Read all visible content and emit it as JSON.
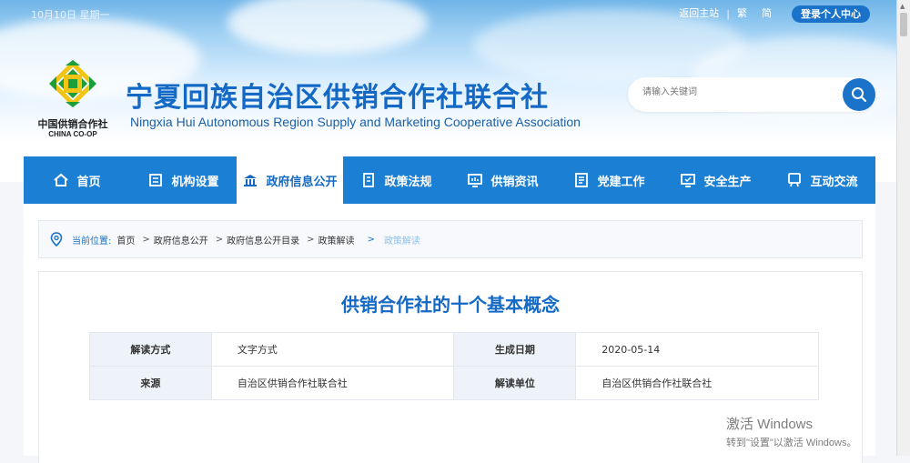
{
  "topbar": {
    "date": "10月10日 星期一",
    "home_link": "返回主站",
    "separator": "|",
    "trad": "繁",
    "simp": "简",
    "login": "登录个人中心"
  },
  "header": {
    "logo_text_cn": "中国供销合作社",
    "logo_text_en": "CHINA CO-OP",
    "title_cn": "宁夏回族自治区供销合作社联合社",
    "title_en": "Ningxia Hui Autonomous Region Supply and Marketing Cooperative Association",
    "search_placeholder": "请输入关键词"
  },
  "nav": {
    "items": [
      {
        "label": "首页",
        "icon": "home-icon"
      },
      {
        "label": "机构设置",
        "icon": "org-icon"
      },
      {
        "label": "政府信息公开",
        "icon": "government-icon",
        "active": true
      },
      {
        "label": "政策法规",
        "icon": "policy-icon"
      },
      {
        "label": "供销资讯",
        "icon": "news-icon"
      },
      {
        "label": "党建工作",
        "icon": "party-icon"
      },
      {
        "label": "安全生产",
        "icon": "safety-icon"
      },
      {
        "label": "互动交流",
        "icon": "interaction-icon"
      }
    ]
  },
  "breadcrumb": {
    "label": "当前位置:",
    "items": [
      "首页",
      "政府信息公开",
      "政府信息公开目录",
      "政策解读"
    ],
    "arrow": ">",
    "current": "政策解读"
  },
  "article": {
    "title": "供销合作社的十个基本概念",
    "meta": {
      "k1": "解读方式",
      "v1": "文字方式",
      "k2": "生成日期",
      "v2": "2020-05-14",
      "k3": "来源",
      "v3": "自治区供销合作社联合社",
      "k4": "解读单位",
      "v4": "自治区供销合作社联合社"
    }
  },
  "watermark": {
    "line1": "激活 Windows",
    "line2": "转到\"设置\"以激活 Windows。"
  },
  "colors": {
    "brand_blue": "#1b7fd4",
    "title_blue": "#1469c5",
    "logo_green": "#1e9e3a",
    "logo_yellow": "#f2c413"
  }
}
